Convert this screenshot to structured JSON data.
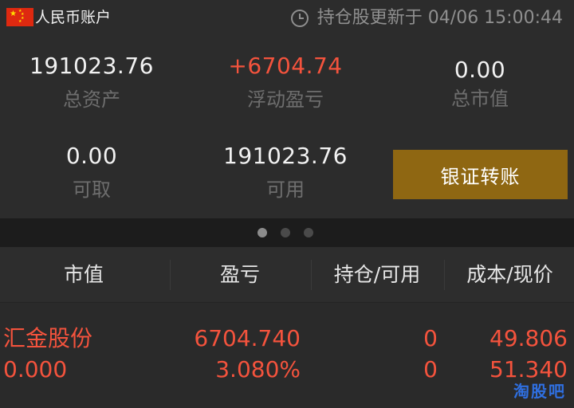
{
  "header": {
    "account_label": "人民币账户",
    "updated_text": "持仓股更新于 04/06 15:00:44"
  },
  "summary": {
    "total_assets": {
      "value": "191023.76",
      "label": "总资产"
    },
    "floating_pl": {
      "value": "+6704.74",
      "label": "浮动盈亏"
    },
    "market_value": {
      "value": "0.00",
      "label": "总市值"
    },
    "withdrawable": {
      "value": "0.00",
      "label": "可取"
    },
    "available": {
      "value": "191023.76",
      "label": "可用"
    },
    "transfer_button": "银证转账"
  },
  "pager": {
    "pages": 3,
    "active": 0
  },
  "table": {
    "headers": [
      "市值",
      "盈亏",
      "持仓/可用",
      "成本/现价"
    ],
    "rows": [
      {
        "name": "汇金股份",
        "market_value": "0.000",
        "pl": "6704.740",
        "pl_pct": "3.080%",
        "position": "0",
        "available": "0",
        "cost": "49.806",
        "price": "51.340"
      }
    ]
  },
  "watermark": "淘股吧",
  "colors": {
    "accent": "#8f6712",
    "positive": "#f4533d",
    "muted": "#6e6e6e"
  }
}
